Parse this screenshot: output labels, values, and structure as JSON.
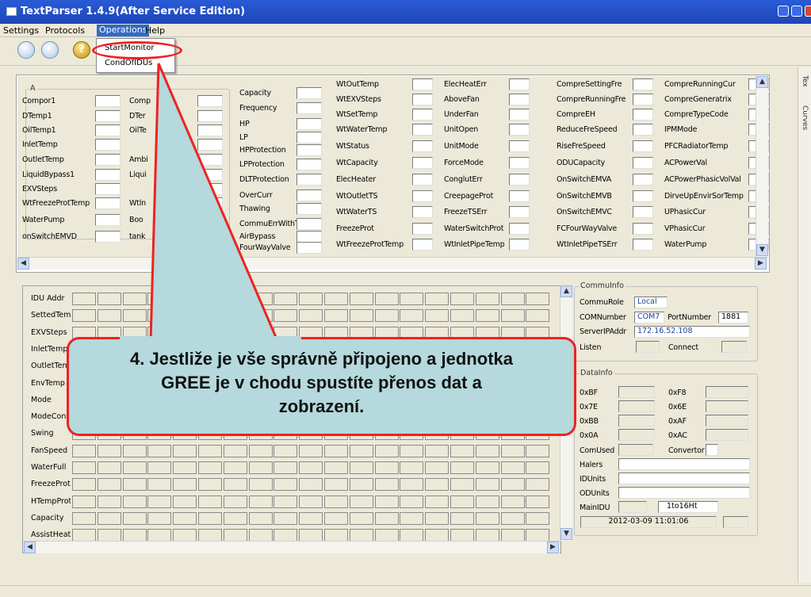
{
  "window": {
    "title": "TextParser 1.4.9(After Service Edition)"
  },
  "menu": {
    "settings": "Settings",
    "protocols": "Protocols",
    "operations": "Operations",
    "help": "Help"
  },
  "dropdown": {
    "start": "StartMonitor",
    "cond": "CondOfIDUs"
  },
  "toolbar": {
    "help": "?"
  },
  "top": {
    "group_a": "A",
    "col1": [
      "Compor1",
      "DTemp1",
      "OilTemp1",
      "InletTemp",
      "OutletTemp",
      "LiquidBypass1",
      "EXVSteps",
      "WtFreezeProtTemp",
      "WaterPump",
      "onSwitchEMVD"
    ],
    "col2": [
      "Comp",
      "DTer",
      "OilTe",
      "",
      "Ambi",
      "Liqui",
      "",
      "Wtln",
      "Boo",
      "tank"
    ],
    "col3": [
      "Capacity",
      "Frequency",
      "HP",
      "LP",
      "HPProtection",
      "LPProtection",
      "DLTProtection",
      "OverCurr",
      "Thawing",
      "CommuErrWithT",
      "AirBypass",
      "FourWayValve"
    ],
    "col4": [
      "WtOutTemp",
      "WtEXVSteps",
      "WtSetTemp",
      "WtWaterTemp",
      "WtStatus",
      "WtCapacity",
      "ElecHeater",
      "WtOutletTS",
      "WtWaterTS",
      "FreezeProt",
      "WtFreezeProtTemp"
    ],
    "col5": [
      "ElecHeatErr",
      "AboveFan",
      "UnderFan",
      "UnitOpen",
      "UnitMode",
      "ForceMode",
      "ConglutErr",
      "CreepageProt",
      "FreezeTSErr",
      "WaterSwitchProt",
      "WtInletPipeTemp"
    ],
    "col6": [
      "CompreSettingFre",
      "CompreRunningFre",
      "CompreEH",
      "ReduceFreSpeed",
      "RiseFreSpeed",
      "ODUCapacity",
      "OnSwitchEMVA",
      "OnSwitchEMVB",
      "OnSwitchEMVC",
      "FCFourWayValve",
      "WtInletPipeTSErr"
    ],
    "col7": [
      "CompreRunningCur",
      "CompreGeneratrix",
      "CompreTypeCode",
      "IPMMode",
      "PFCRadiatorTemp",
      "ACPowerVal",
      "ACPowerPhasicVolVal",
      "DirveUpEnvirSorTemp",
      "UPhasicCur",
      "VPhasicCur",
      "WaterPump"
    ]
  },
  "grid": {
    "rows": [
      "IDU Addr",
      "SettedTemp",
      "EXVSteps",
      "InletTemp",
      "OutletTemp",
      "EnvTemp",
      "Mode",
      "ModeCon",
      "Swing",
      "FanSpeed",
      "WaterFull",
      "FreezeProt",
      "HTempProt",
      "Capacity",
      "AssistHeat"
    ]
  },
  "commu": {
    "title": "CommuInfo",
    "role_label": "CommuRole",
    "role_value": "Local",
    "com_label": "COMNumber",
    "com_value": "COM7",
    "port_label": "PortNumber",
    "port_value": "1881",
    "ip_label": "ServerIPAddr",
    "ip_value": "172.16.52.108",
    "listen": "Listen",
    "connect": "Connect"
  },
  "datainfo": {
    "title": "DataInfo",
    "left": [
      "0xBF",
      "0x7E",
      "0xBB",
      "0x0A"
    ],
    "right": [
      "0xF8",
      "0x6E",
      "0xAF",
      "0xAC"
    ],
    "comused": "ComUsed",
    "convertor": "Convertor",
    "halers": "Halers",
    "idunits": "IDUnits",
    "odunits": "ODUnits",
    "mainidu": "MainIDU",
    "mainidu_value": "1to16Ht",
    "datetime": "2012-03-09 11:01:06"
  },
  "sidetabs": {
    "first": "Tex",
    "curves": "Curves"
  },
  "callout": {
    "line1": "4. Jestliže je vše správně připojeno a jednotka",
    "line2": "GREE je v chodu spustíte přenos dat a",
    "line3": "zobrazení."
  },
  "colors": {
    "title": "#1d45b8",
    "callout_bg": "#b5d9dc",
    "callout_border": "#ee2222"
  }
}
